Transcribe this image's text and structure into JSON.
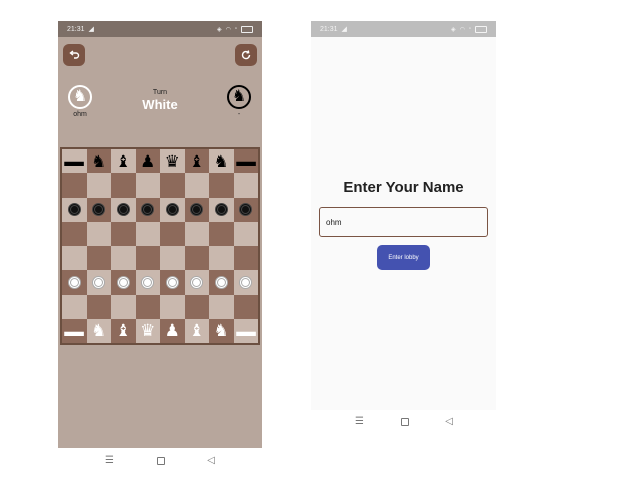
{
  "colors": {
    "accent_brown": "#7a5444",
    "board_light": "#c9b8ae",
    "board_dark": "#8d6a5b",
    "lobby_button": "#4452b0"
  },
  "game_screen": {
    "status_time": "21:31",
    "undo_icon": "undo-arrow-icon",
    "restart_icon": "refresh-icon",
    "player_left": {
      "piece_icon": "white-knight-icon",
      "name": "ohm"
    },
    "player_right": {
      "piece_icon": "black-knight-icon",
      "name": "-"
    },
    "turn_label": "Turn",
    "turn_value": "White",
    "board": [
      [
        "b-pawnstack",
        "b-knight",
        "b-bishop",
        "b-pawn",
        "b-queen",
        "b-bishop",
        "b-knight",
        "b-pawnstack"
      ],
      [
        "",
        "",
        "",
        "",
        "",
        "",
        "",
        ""
      ],
      [
        "b-disc",
        "b-disc",
        "b-disc",
        "b-disc",
        "b-disc",
        "b-disc",
        "b-disc",
        "b-disc"
      ],
      [
        "",
        "",
        "",
        "",
        "",
        "",
        "",
        ""
      ],
      [
        "",
        "",
        "",
        "",
        "",
        "",
        "",
        ""
      ],
      [
        "w-disc",
        "w-disc",
        "w-disc",
        "w-disc",
        "w-disc",
        "w-disc",
        "w-disc",
        "w-disc"
      ],
      [
        "",
        "",
        "",
        "",
        "",
        "",
        "",
        ""
      ],
      [
        "w-pawnstack",
        "w-knight",
        "w-bishop",
        "w-queen",
        "w-pawn",
        "w-bishop",
        "w-knight",
        "w-pawnstack"
      ]
    ],
    "nav": {
      "menu": "☰",
      "home": "",
      "back": "◁"
    }
  },
  "name_screen": {
    "status_time": "21:31",
    "title": "Enter Your Name",
    "name_value": "ohm",
    "button_label": "Enter lobby",
    "nav": {
      "menu": "☰",
      "home": "",
      "back": "◁"
    }
  }
}
